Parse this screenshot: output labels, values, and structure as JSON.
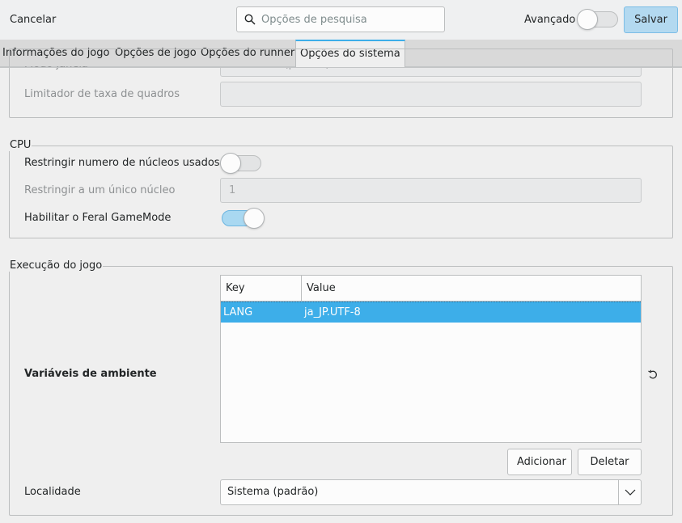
{
  "header": {
    "cancel_label": "Cancelar",
    "search_placeholder": "Opções de pesquisa",
    "advanced_label": "Avançado",
    "advanced_on": false,
    "save_label": "Salvar"
  },
  "tabs": [
    {
      "label": "Informações do jogo",
      "active": false
    },
    {
      "label": "Opções de jogo",
      "active": false
    },
    {
      "label": "Opções do runner",
      "active": false
    },
    {
      "label": "Opções do sistema",
      "active": true
    }
  ],
  "display": {
    "window_mode_label": "Modo janela",
    "window_mode_value": "Tela cheia (padrão)",
    "frame_limiter_label": "Limitador de taxa de quadros",
    "frame_limiter_value": ""
  },
  "cpu": {
    "title": "CPU",
    "restrict_cores_label": "Restringir numero de núcleos usados",
    "restrict_cores_on": false,
    "single_core_label": "Restringir a um único núcleo",
    "single_core_value": "1",
    "gamemode_label": "Habilitar o Feral GameMode",
    "gamemode_on": true
  },
  "execution": {
    "title": "Execução do jogo",
    "env_label": "Variáveis de ambiente",
    "columns": [
      "Key",
      "Value"
    ],
    "rows": [
      {
        "key": "LANG",
        "value": "ja_JP.UTF-8",
        "selected": true
      }
    ],
    "add_label": "Adicionar",
    "delete_label": "Deletar",
    "locale_label": "Localidade",
    "locale_value": "Sistema (padrão)"
  },
  "icons": {
    "search": "search-icon",
    "reset": "reset-icon",
    "dropdown": "chevron-down-icon"
  },
  "colors": {
    "accent": "#3daee9",
    "save_button": "#b3d9f0"
  }
}
